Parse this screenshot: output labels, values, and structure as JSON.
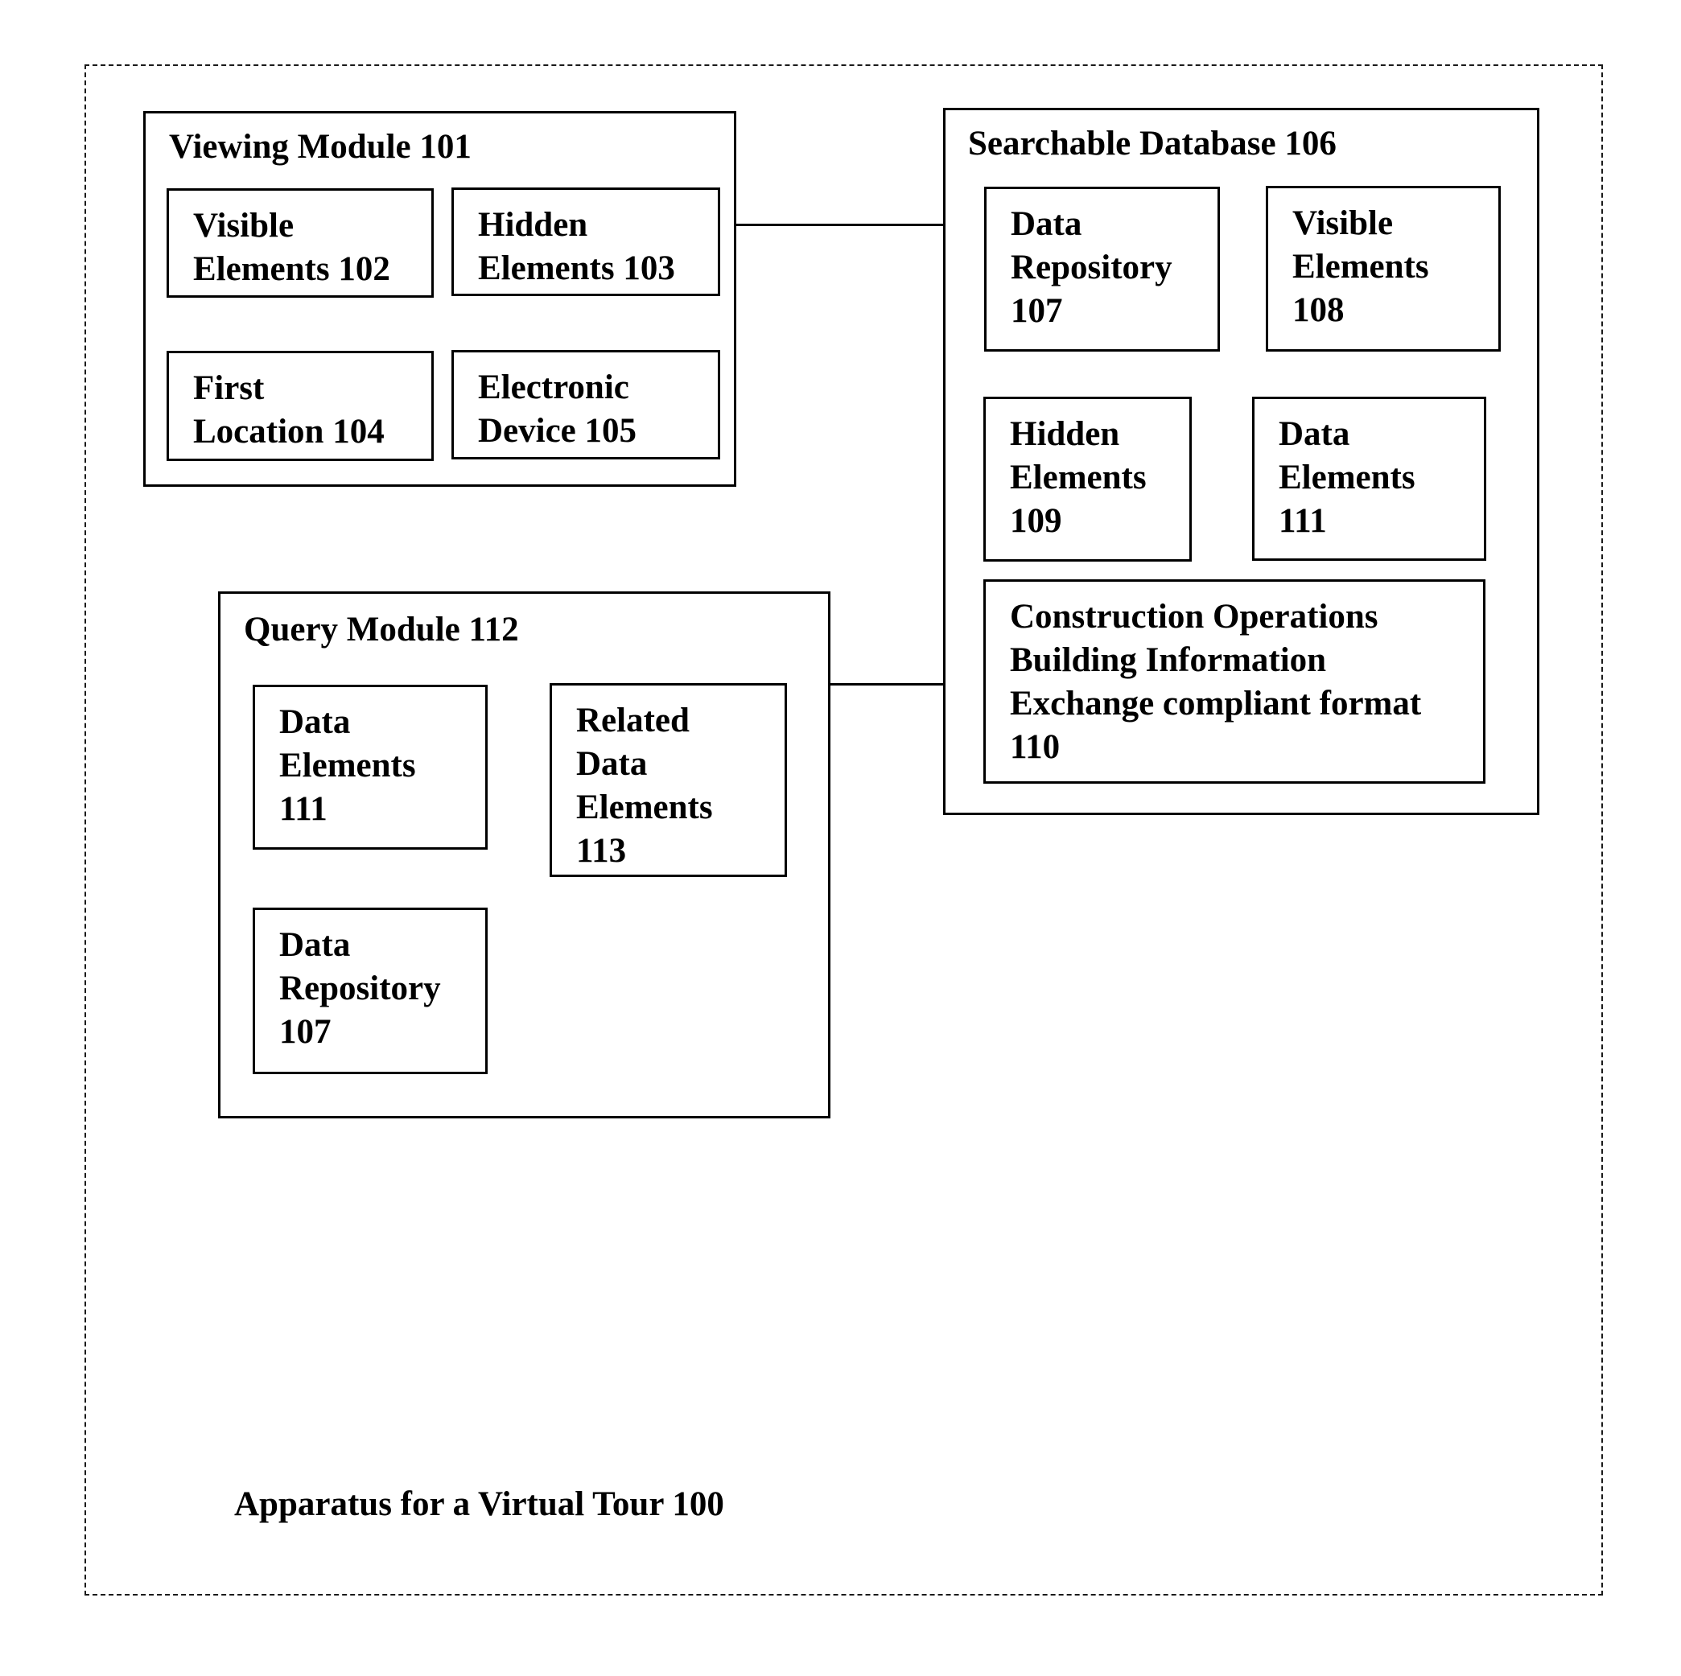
{
  "diagram": {
    "title": "Apparatus for a Virtual Tour 100",
    "viewing_module": {
      "title": "Viewing Module 101",
      "children": [
        {
          "lines": [
            "Visible",
            "Elements 102"
          ]
        },
        {
          "lines": [
            "Hidden",
            "Elements 103"
          ]
        },
        {
          "lines": [
            "First",
            "Location 104"
          ]
        },
        {
          "lines": [
            "Electronic",
            "Device 105"
          ]
        }
      ]
    },
    "searchable_database": {
      "title": "Searchable Database 106",
      "children": [
        {
          "lines": [
            "Data",
            "Repository",
            "107"
          ]
        },
        {
          "lines": [
            "Visible",
            "Elements",
            "108"
          ]
        },
        {
          "lines": [
            "Hidden",
            "Elements",
            "109"
          ]
        },
        {
          "lines": [
            "Data",
            "Elements",
            "111"
          ]
        },
        {
          "lines": [
            "Construction Operations",
            "Building Information",
            "Exchange compliant format",
            "110"
          ]
        }
      ]
    },
    "query_module": {
      "title": "Query Module 112",
      "children": [
        {
          "lines": [
            "Data",
            "Elements",
            "111"
          ]
        },
        {
          "lines": [
            "Related",
            "Data",
            "Elements",
            "113"
          ]
        },
        {
          "lines": [
            "Data",
            "Repository",
            "107"
          ]
        }
      ]
    },
    "connections": [
      {
        "from": "Viewing Module 101",
        "to": "Searchable Database 106"
      },
      {
        "from": "Query Module 112",
        "to": "Searchable Database 106"
      }
    ]
  }
}
